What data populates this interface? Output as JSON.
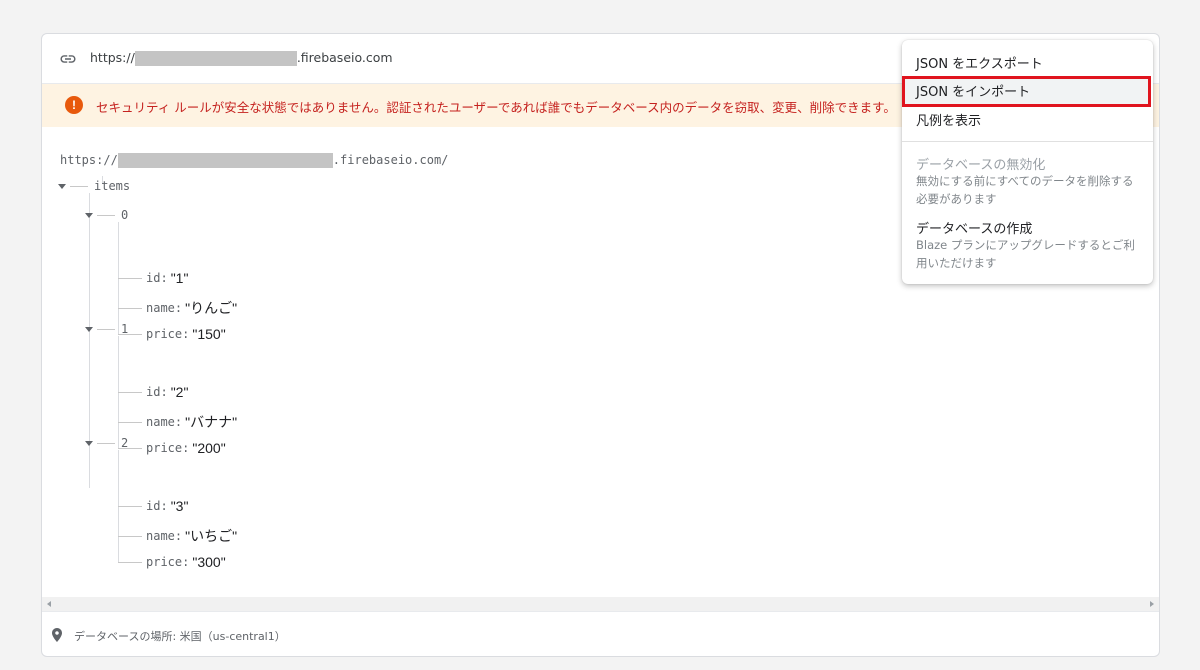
{
  "urlbar": {
    "prefix": "https://",
    "suffix": ".firebaseio.com",
    "icon": "link-icon"
  },
  "warning": {
    "icon": "exclamation-circle-icon",
    "text": "セキュリティ ルールが安全な状態ではありません。認証されたユーザーであれば誰でもデータベース内のデータを窃取、変更、削除できます。"
  },
  "tree": {
    "root_prefix": "https://",
    "root_suffix": ".firebaseio.com/",
    "items_key": "items",
    "nodes": [
      {
        "key": "0",
        "fields": [
          {
            "k": "id:",
            "v": "\"1\""
          },
          {
            "k": "name:",
            "v": "\"りんご\""
          },
          {
            "k": "price:",
            "v": "\"150\""
          }
        ]
      },
      {
        "key": "1",
        "fields": [
          {
            "k": "id:",
            "v": "\"2\""
          },
          {
            "k": "name:",
            "v": "\"バナナ\""
          },
          {
            "k": "price:",
            "v": "\"200\""
          }
        ]
      },
      {
        "key": "2",
        "fields": [
          {
            "k": "id:",
            "v": "\"3\""
          },
          {
            "k": "name:",
            "v": "\"いちご\""
          },
          {
            "k": "price:",
            "v": "\"300\""
          }
        ]
      }
    ]
  },
  "footer": {
    "icon": "location-pin-icon",
    "text": "データベースの場所: 米国（us-central1）"
  },
  "menu": {
    "export": "JSON をエクスポート",
    "import": "JSON をインポート",
    "legend": "凡例を表示",
    "disable_title": "データベースの無効化",
    "disable_sub1": "無効にする前にすべてのデータを削除する",
    "disable_sub2": "必要があります",
    "create_title": "データベースの作成",
    "create_sub1": "Blaze プランにアップグレードするとご利",
    "create_sub2": "用いただけます"
  },
  "colors": {
    "warning_bg": "#fef3e2",
    "warning_text": "#c5221f",
    "highlight_border": "#e0141e"
  }
}
